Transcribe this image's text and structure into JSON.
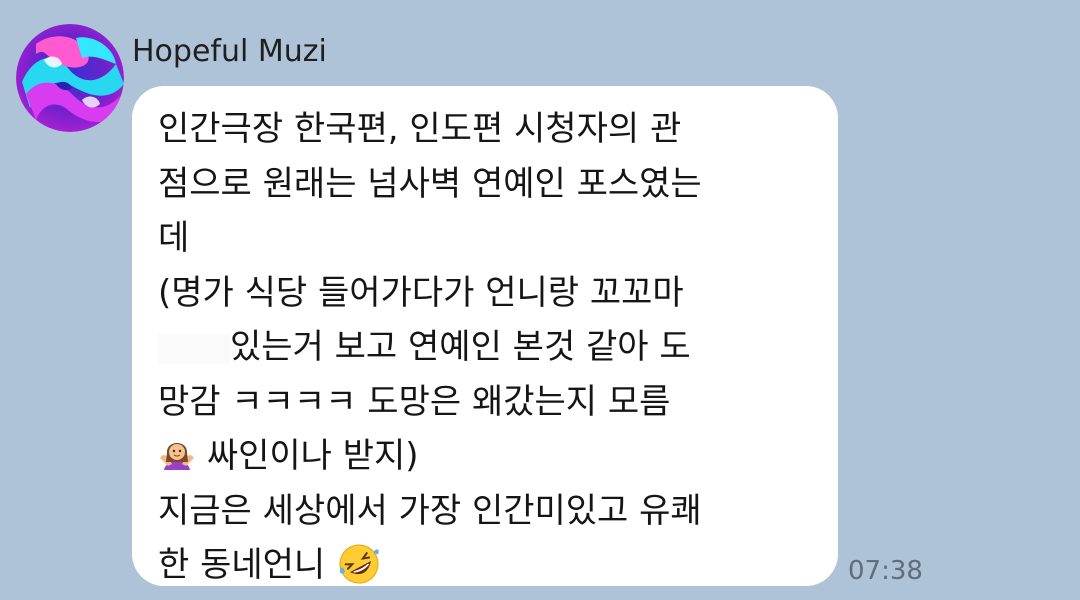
{
  "message": {
    "sender": "Hopeful Muzi",
    "avatar_icon": "swirl-avatar-icon",
    "lines": [
      "인간극장 한국편, 인도편 시청자의 관",
      "점으로 원래는 넘사벽 연예인 포스였는",
      "데",
      "(명가 식당 들어가다가 언니랑 꼬꼬마",
      "있는거 보고 연예인 본것 같아 도",
      "망감 ㅋㅋㅋㅋ 도망은 왜갔는지 모름",
      "싸인이나 받지)",
      "지금은 세상에서 가장 인간미있고 유쾌",
      "한 동네언니"
    ],
    "emojis": {
      "line7": "shrugging-woman-emoji",
      "line9": "rolling-on-floor-laughing-emoji"
    },
    "time": "07:38"
  },
  "colors": {
    "background": "#aec3d7",
    "bubble": "#ffffff",
    "text": "#151515",
    "time": "#5f6d7c"
  }
}
